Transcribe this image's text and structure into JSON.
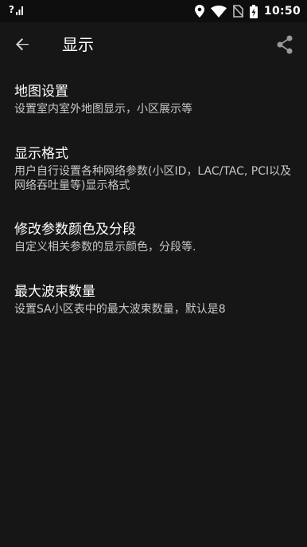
{
  "status_bar": {
    "signal_text": "?",
    "time": "10:50",
    "icons": [
      "signal-unknown-icon",
      "location-icon",
      "wifi-icon",
      "sim-off-icon",
      "battery-charging-icon"
    ]
  },
  "app_bar": {
    "back_icon": "arrow-back-icon",
    "title": "显示",
    "share_icon": "share-icon"
  },
  "preferences": [
    {
      "title": "地图设置",
      "summary": "设置室内室外地图显示，小区展示等"
    },
    {
      "title": "显示格式",
      "summary": "用户自行设置各种网络参数(小区ID，LAC/TAC, PCI以及网络吞吐量等)显示格式"
    },
    {
      "title": "修改参数颜色及分段",
      "summary": "自定义相关参数的显示颜色，分段等."
    },
    {
      "title": "最大波束数量",
      "summary": "设置SA小区表中的最大波束数量，默认是8"
    }
  ],
  "colors": {
    "background": "#161616",
    "status_bar": "#0e0e0e",
    "title_text": "#ffffff",
    "summary_text": "#c8c8c8"
  }
}
